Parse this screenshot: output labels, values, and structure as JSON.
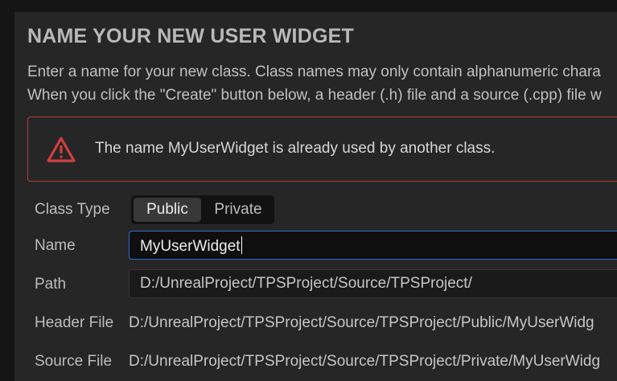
{
  "dialog": {
    "title": "NAME YOUR NEW USER WIDGET",
    "description_line1": "Enter a name for your new class. Class names may only contain alphanumeric chara",
    "description_line2": "When you click the \"Create\" button below, a header (.h) file and a source (.cpp) file w"
  },
  "error": {
    "icon": "warning-icon",
    "message": "The name MyUserWidget is already used by another class.",
    "color": "#b53a3a"
  },
  "form": {
    "class_type": {
      "label": "Class Type",
      "options": [
        "Public",
        "Private"
      ],
      "selected": "Public"
    },
    "name": {
      "label": "Name",
      "value": "MyUserWidget"
    },
    "path": {
      "label": "Path",
      "value": "D:/UnrealProject/TPSProject/Source/TPSProject/"
    },
    "header_file": {
      "label": "Header File",
      "value": "D:/UnrealProject/TPSProject/Source/TPSProject/Public/MyUserWidg"
    },
    "source_file": {
      "label": "Source File",
      "value": "D:/UnrealProject/TPSProject/Source/TPSProject/Private/MyUserWidg"
    }
  },
  "colors": {
    "background": "#151515",
    "panel": "#262626",
    "focus_accent": "#2f6fd0"
  }
}
